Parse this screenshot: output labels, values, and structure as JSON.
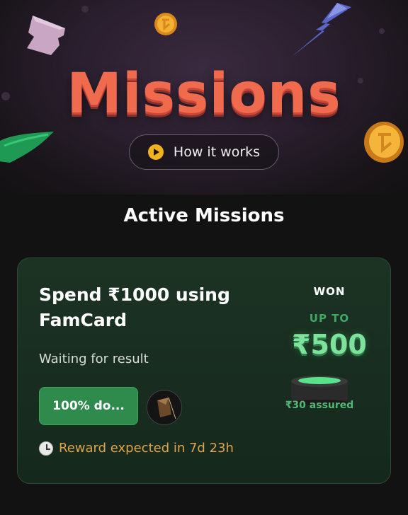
{
  "hero": {
    "title": "Missions",
    "how_it_works_label": "How it works"
  },
  "section": {
    "title": "Active Missions"
  },
  "mission": {
    "title": "Spend ₹1000 using FamCard",
    "status": "Waiting for result",
    "progress_label": "100% do...",
    "reward_eta": "Reward expected in 7d 23h",
    "won_label": "WON",
    "up_to_label": "UP TO",
    "reward_amount": "₹500",
    "assured_text": "₹30 assured"
  },
  "colors": {
    "title_coral": "#f06a4e",
    "accent_green": "#2f8b4c",
    "reward_green": "#7ee29d",
    "eta_amber": "#e0a44b",
    "play_yellow": "#f2b21c"
  },
  "icons": {
    "play": "play-icon",
    "clock": "clock-icon",
    "coin": "coin-icon",
    "bolt": "lightning-bolt-icon"
  }
}
